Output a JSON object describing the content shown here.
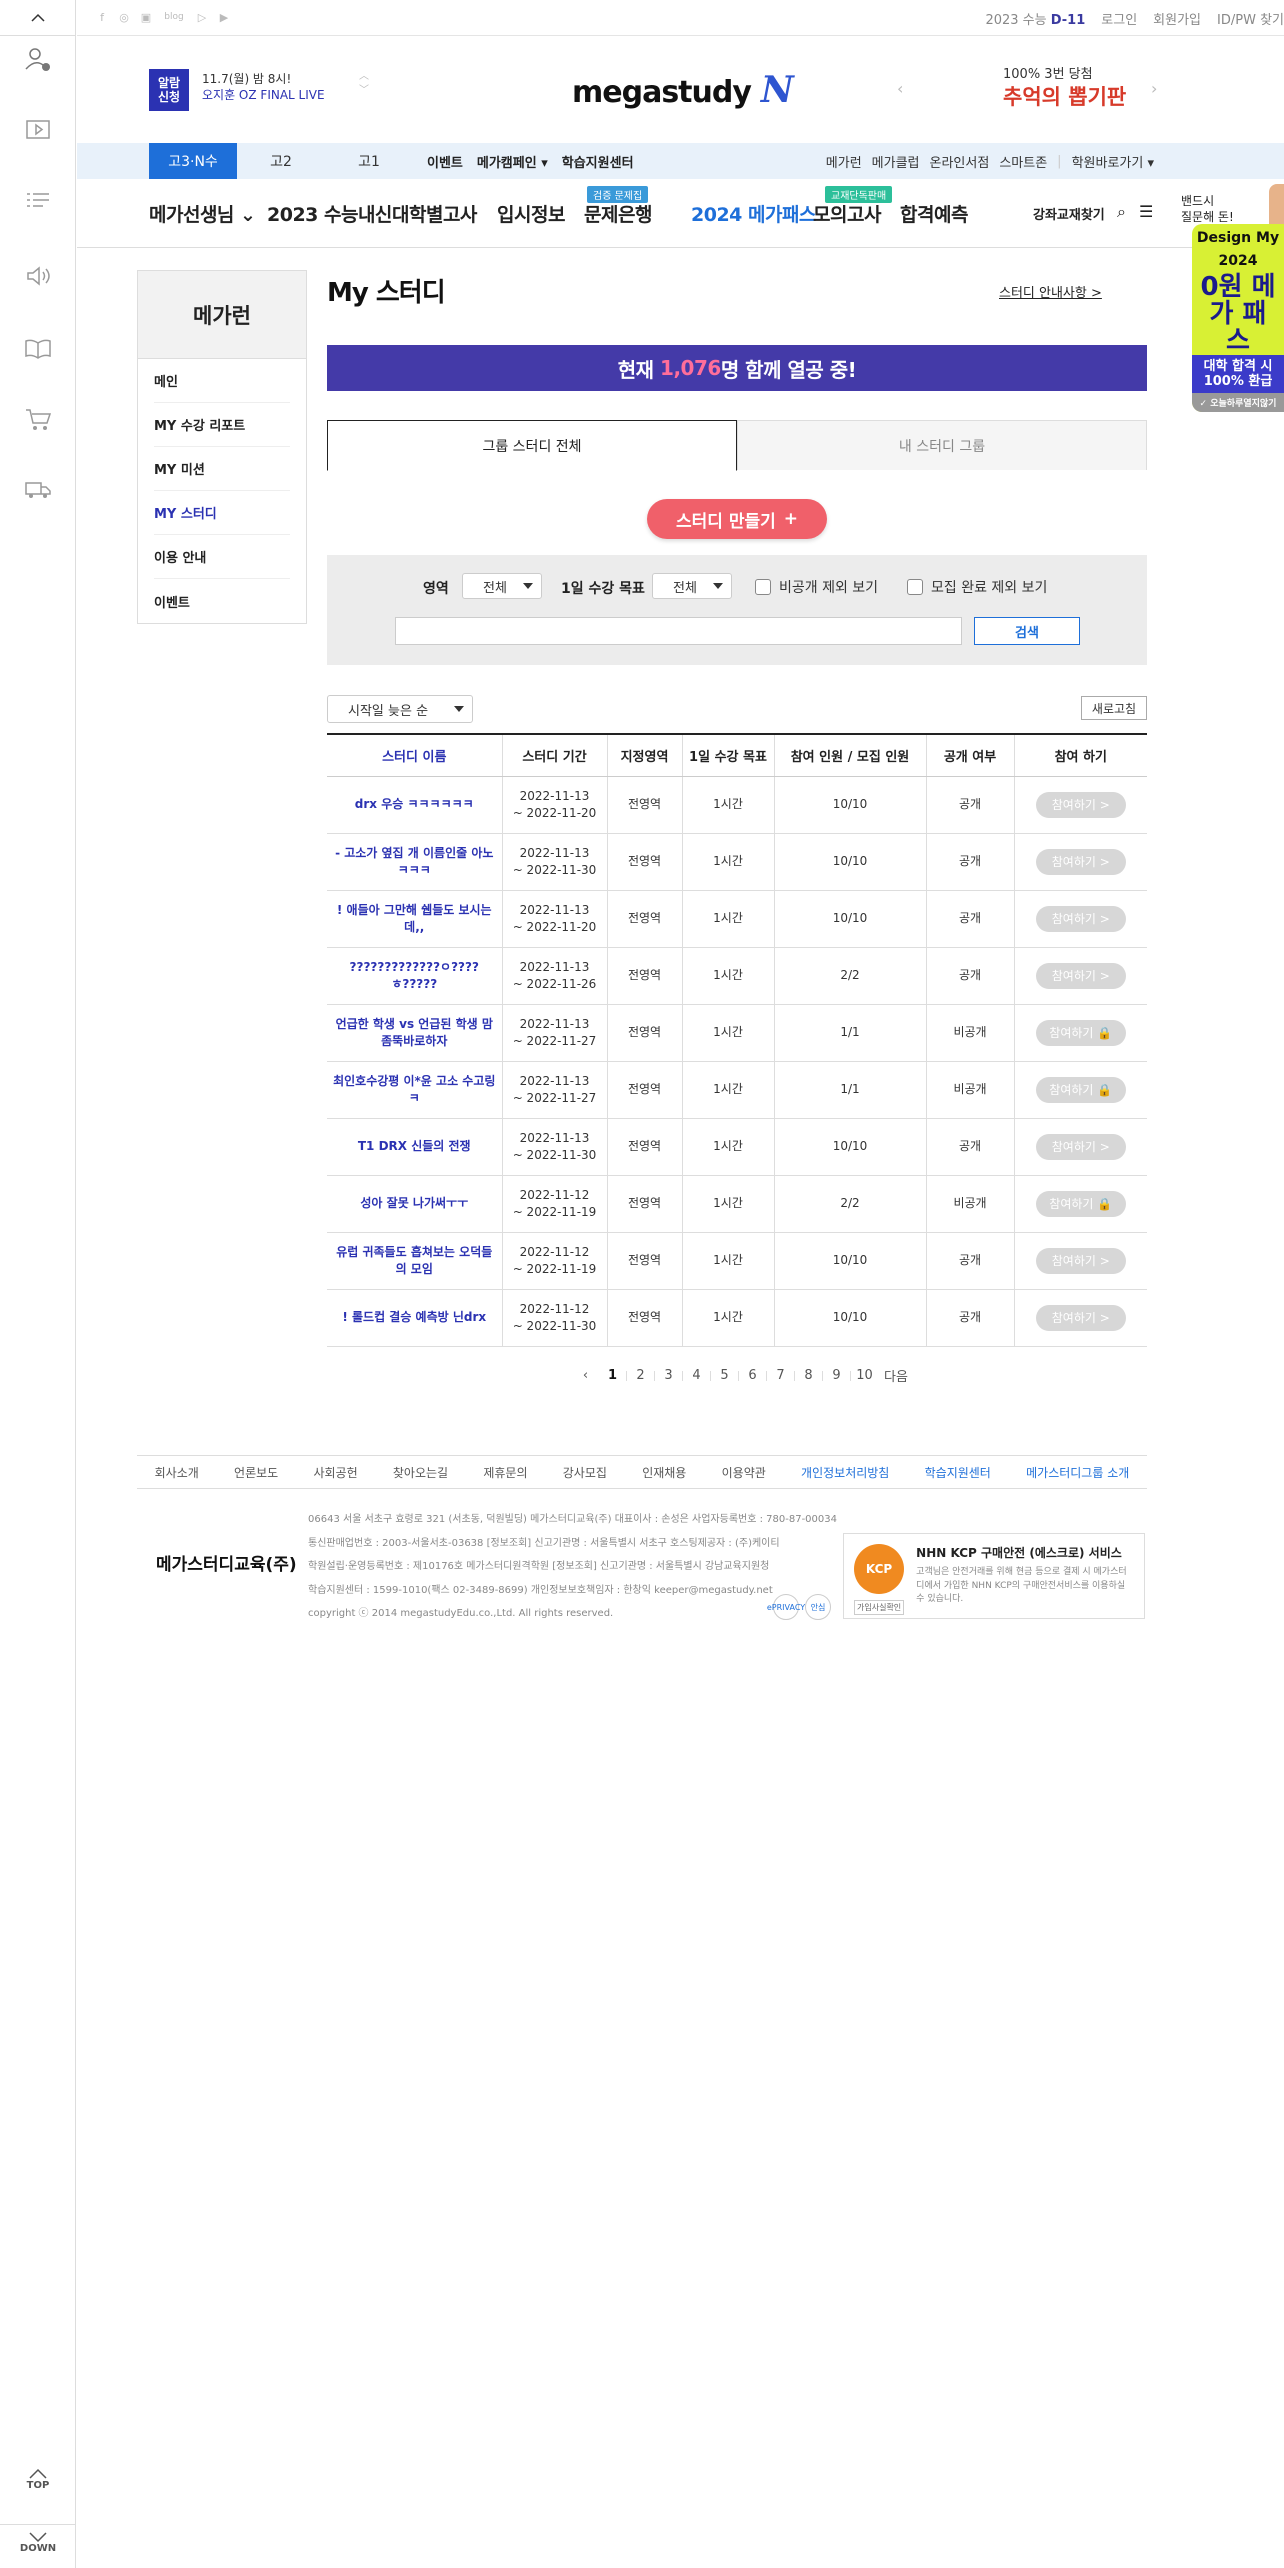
{
  "rail": {
    "top_label": "TOP",
    "down_label": "DOWN"
  },
  "topbar": {
    "social": [
      "f",
      "◎",
      "▣",
      "blog",
      "▷",
      "▶"
    ],
    "dday_prefix": "2023 수능",
    "dday": "D-11",
    "links": [
      "로그인",
      "회원가입",
      "ID/PW 찾기"
    ]
  },
  "header": {
    "alarm_line1": "알람",
    "alarm_line2": "신청",
    "alarm_text1": "11.7(월) 밤 8시!",
    "alarm_text2": "오지훈 OZ FINAL LIVE",
    "logo": "megastudy",
    "logo_mark": "N",
    "promo_small": "100% 3번 당첨",
    "promo_big": "추억의 뽑기판"
  },
  "grades": {
    "tabs": [
      "고3·N수",
      "고2",
      "고1"
    ],
    "links": [
      "이벤트",
      "메가캠페인",
      "학습지원센터"
    ],
    "links_right": [
      "메가런",
      "메가클럽",
      "온라인서점",
      "스마트존",
      "학원바로가기"
    ]
  },
  "mainnav": {
    "items": [
      "메가선생님",
      "2023 수능내신",
      "대학별고사",
      "입시정보",
      "문제은행",
      "2024 메가패스",
      "모의고사",
      "합격예측"
    ],
    "badge_bank": "검증 문제집",
    "badge_mock": "교재단독판매",
    "search": "강좌교재찾기",
    "side_text1": "밴드시",
    "side_text2": "질문해 돈!"
  },
  "sidebanner": {
    "l1": "Design My",
    "l2": "2024",
    "big": "0원 메가 패스",
    "sub1": "대학 합격 시",
    "sub2": "100% 환급",
    "foot": "오늘하루열지않기"
  },
  "leftmenu": {
    "title": "메가런",
    "items": [
      "메인",
      "MY 수강 리포트",
      "MY 미션",
      "MY 스터디",
      "이용 안내",
      "이벤트"
    ]
  },
  "page": {
    "title": "My 스터디",
    "guide": "스터디 안내사항 >",
    "live_prefix": "현재 ",
    "live_count": "1,076",
    "live_suffix": "명 함께 열공 중!",
    "tab_all": "그룹 스터디 전체",
    "tab_mine": "내 스터디 그룹",
    "make_btn": "스터디 만들기",
    "make_plus": "+",
    "filter": {
      "area_label": "영역",
      "area_value": "전체",
      "goal_label": "1일 수강 목표",
      "goal_value": "전체",
      "chk_private": "비공개 제외 보기",
      "chk_done": "모집 완료 제외 보기",
      "search_btn": "검색",
      "search_value": ""
    },
    "sort": "시작일 늦은 순",
    "refresh": "새로고침"
  },
  "table": {
    "headers": [
      "스터디 이름",
      "스터디 기간",
      "지정영역",
      "1일 수강 목표",
      "참여 인원 / 모집 인원",
      "공개 여부",
      "참여 하기"
    ],
    "rows": [
      {
        "name": "drx 우승 ㅋㅋㅋㅋㅋㅋ",
        "start": "2022-11-13",
        "end": "~ 2022-11-20",
        "area": "전영역",
        "goal": "1시간",
        "members": "10/10",
        "open": "공개",
        "join": "참여하기 >"
      },
      {
        "name": "- 고소가 옆집 개 이름인줄 아노ㅋㅋㅋ",
        "start": "2022-11-13",
        "end": "~ 2022-11-30",
        "area": "전영역",
        "goal": "1시간",
        "members": "10/10",
        "open": "공개",
        "join": "참여하기 >"
      },
      {
        "name": "! 애들아 그만해 쉡들도 보시는데,,",
        "start": "2022-11-13",
        "end": "~ 2022-11-20",
        "area": "전영역",
        "goal": "1시간",
        "members": "10/10",
        "open": "공개",
        "join": "참여하기 >"
      },
      {
        "name": "?????????????ㅇ????ㅎ?????",
        "start": "2022-11-13",
        "end": "~ 2022-11-26",
        "area": "전영역",
        "goal": "1시간",
        "members": "2/2",
        "open": "공개",
        "join": "참여하기 >"
      },
      {
        "name": "언급한 학생 vs 언급된 학생 맘좀뚝바로하자",
        "start": "2022-11-13",
        "end": "~ 2022-11-27",
        "area": "전영역",
        "goal": "1시간",
        "members": "1/1",
        "open": "비공개",
        "join": "참여하기 🔒"
      },
      {
        "name": "최인호수강평 이*윤 고소 수고링ㅋ",
        "start": "2022-11-13",
        "end": "~ 2022-11-27",
        "area": "전영역",
        "goal": "1시간",
        "members": "1/1",
        "open": "비공개",
        "join": "참여하기 🔒"
      },
      {
        "name": "T1 DRX 신들의 전쟁",
        "start": "2022-11-13",
        "end": "~ 2022-11-30",
        "area": "전영역",
        "goal": "1시간",
        "members": "10/10",
        "open": "공개",
        "join": "참여하기 >"
      },
      {
        "name": "성아 잘못 나가써ㅜㅜ",
        "start": "2022-11-12",
        "end": "~ 2022-11-19",
        "area": "전영역",
        "goal": "1시간",
        "members": "2/2",
        "open": "비공개",
        "join": "참여하기 🔒"
      },
      {
        "name": "유럽 귀족들도 흡쳐보는 오덕들의 모임",
        "start": "2022-11-12",
        "end": "~ 2022-11-19",
        "area": "전영역",
        "goal": "1시간",
        "members": "10/10",
        "open": "공개",
        "join": "참여하기 >"
      },
      {
        "name": "! 롤드컵 결승 예측방 닌drx",
        "start": "2022-11-12",
        "end": "~ 2022-11-30",
        "area": "전영역",
        "goal": "1시간",
        "members": "10/10",
        "open": "공개",
        "join": "참여하기 >"
      }
    ]
  },
  "pager": {
    "prev": "‹",
    "pages": [
      "1",
      "2",
      "3",
      "4",
      "5",
      "6",
      "7",
      "8",
      "9",
      "10"
    ],
    "next": "다음"
  },
  "footer": {
    "links": [
      "회사소개",
      "언론보도",
      "사회공헌",
      "찾아오는길",
      "제휴문의",
      "강사모집",
      "인재채용",
      "이용약관",
      "개인정보처리방침",
      "학습지원센터",
      "메가스터디그룹 소개"
    ],
    "company": "메가스터디교육(주)",
    "info": [
      "06643 서울 서초구 효령로 321 (서초동, 덕원빌딩) 메가스터디교육(주) 대표이사 : 손성은 사업자등록번호 : 780-87-00034",
      "통신판매업번호 : 2003-서울서초-03638 [정보조회] 신고기관명 : 서울특별시 서초구 호스팅제공자 : (주)케이티",
      "학원설립·운영등록번호 : 제10176호 메가스터디원격학원 [정보조회] 신고기관명 : 서울특별시 강남교육지원청",
      "학습지원센터 : 1599-1010(팩스 02-3489-8699) 개인정보보호책임자 : 한창익 keeper@megastudy.net",
      "copyright ⓒ 2014 megastudyEdu.co.,Ltd. All rights reserved."
    ],
    "marks": [
      "ePRIVACY",
      "안심"
    ],
    "kcp_seal": "KCP",
    "kcp_title": "NHN KCP 구매안전 (에스크로) 서비스",
    "kcp_desc": "고객님은 안전거래를 위해 현금 등으로 결제 시 메가스터디에서 가입한 NHN KCP의 구매안전서비스를 이용하실 수 있습니다.",
    "kcp_btn": "가입사실확인"
  }
}
